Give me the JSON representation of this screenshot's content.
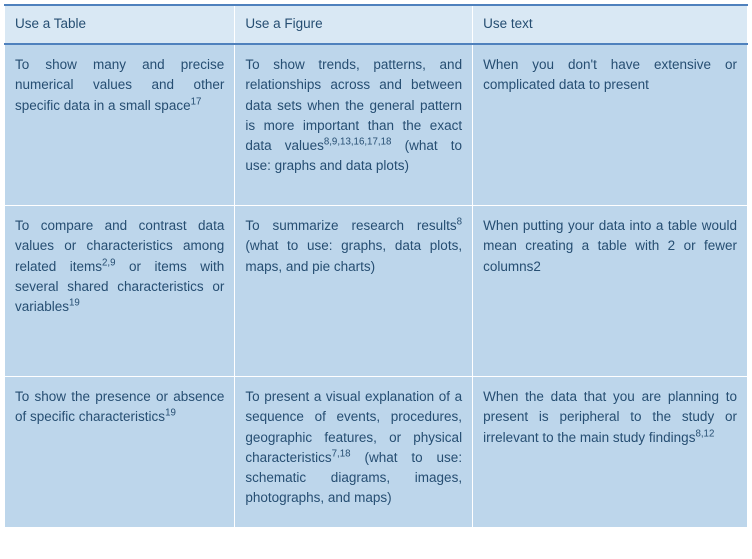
{
  "headers": {
    "col1": "Use a Table",
    "col2": "Use a Figure",
    "col3": "Use text"
  },
  "rows": [
    {
      "table": {
        "text": "To show many and precise numerical values and other specific data in a small space",
        "ref": "17"
      },
      "figure": {
        "text": "To show trends, patterns, and relationships across and between data sets when the general pattern is more important than the exact data values",
        "ref": "8,9,13,16,17,18",
        "tail": " (what to use: graphs and data plots)"
      },
      "text": {
        "text": "When you don't have extensive or complicated data to present"
      }
    },
    {
      "table": {
        "pre": "To compare and contrast data values or characteristics among related items",
        "ref1": "2,9",
        "mid": " or items with several shared characteristics or variables",
        "ref2": "19"
      },
      "figure": {
        "text": "To summarize research results",
        "ref": "8",
        "tail": " (what to use: graphs, data plots, maps, and pie charts)"
      },
      "text": {
        "text": "When putting your data into a table would mean creating a table with 2 or fewer columns2"
      }
    },
    {
      "table": {
        "text": "To show the presence or absence of specific characteristics",
        "ref": "19"
      },
      "figure": {
        "text": "To present a visual explanation of a sequence of events, procedures, geographic features, or physical characteristics",
        "ref": "7,18",
        "tail": " (what to use: schematic diagrams, images, photographs, and maps)"
      },
      "text": {
        "text": "When the data that you are planning to present is peripheral to the study or irrelevant to the main study findings",
        "ref": "8,12"
      }
    }
  ]
}
